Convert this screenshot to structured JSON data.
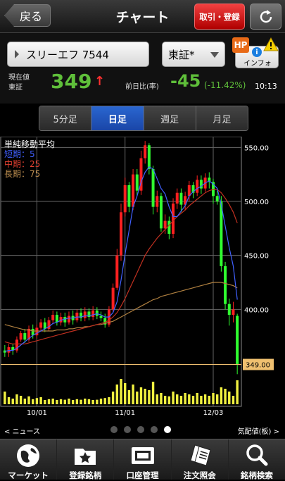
{
  "nav": {
    "back_label": "戻る",
    "title": "チャート",
    "trade_label": "取引・登録"
  },
  "stock": {
    "name": "スリーエフ 7544",
    "market": "東証*",
    "info_label": "インフォ",
    "hp_badge": "HP",
    "info_badge": "i"
  },
  "quote": {
    "current_label_1": "現在値",
    "current_label_2": "東証",
    "price": "349",
    "arrow": "↑",
    "prev_label": "前日比(率)",
    "change": "-45",
    "change_pct": "(-11.42%)",
    "time": "10:13"
  },
  "tabs": [
    {
      "label": "5分足",
      "active": false
    },
    {
      "label": "日足",
      "active": true
    },
    {
      "label": "週足",
      "active": false
    },
    {
      "label": "月足",
      "active": false
    }
  ],
  "legend": {
    "title": "単純移動平均",
    "short": "短期：5",
    "mid": "中期：25",
    "long": "長期：75"
  },
  "colors": {
    "up": "#ff2020",
    "down": "#30ff30",
    "ma_short": "#4060ff",
    "ma_mid": "#c03020",
    "ma_long": "#b08040",
    "volume": "#f0f040",
    "price_tag": "#f0c070"
  },
  "chart_data": {
    "type": "candlestick",
    "ylim": [
      335,
      560
    ],
    "y_ticks": [
      "550.00",
      "500.00",
      "450.00",
      "400.00"
    ],
    "current_price_label": "349.00",
    "current_price": 349,
    "x_ticks": [
      {
        "label": "10/01",
        "index": 8
      },
      {
        "label": "11/01",
        "index": 30
      },
      {
        "label": "12/03",
        "index": 52
      }
    ],
    "candles": [
      [
        362,
        360,
        367,
        356
      ],
      [
        360,
        365,
        368,
        356
      ],
      [
        365,
        362,
        368,
        358
      ],
      [
        362,
        372,
        375,
        360
      ],
      [
        372,
        378,
        380,
        370
      ],
      [
        378,
        372,
        382,
        369
      ],
      [
        372,
        382,
        385,
        370
      ],
      [
        382,
        376,
        386,
        373
      ],
      [
        376,
        383,
        386,
        373
      ],
      [
        383,
        388,
        391,
        380
      ],
      [
        388,
        382,
        392,
        379
      ],
      [
        382,
        390,
        393,
        380
      ],
      [
        390,
        395,
        399,
        387
      ],
      [
        395,
        388,
        398,
        385
      ],
      [
        388,
        393,
        397,
        385
      ],
      [
        393,
        388,
        397,
        384
      ],
      [
        388,
        394,
        398,
        386
      ],
      [
        394,
        390,
        399,
        386
      ],
      [
        390,
        397,
        400,
        388
      ],
      [
        397,
        392,
        401,
        389
      ],
      [
        392,
        398,
        402,
        389
      ],
      [
        398,
        393,
        401,
        390
      ],
      [
        393,
        399,
        403,
        390
      ],
      [
        399,
        394,
        402,
        391
      ],
      [
        394,
        392,
        398,
        389
      ],
      [
        392,
        386,
        396,
        383
      ],
      [
        386,
        400,
        403,
        384
      ],
      [
        400,
        420,
        424,
        398
      ],
      [
        420,
        450,
        456,
        418
      ],
      [
        450,
        490,
        498,
        445
      ],
      [
        490,
        515,
        522,
        486
      ],
      [
        515,
        495,
        518,
        490
      ],
      [
        495,
        525,
        530,
        492
      ],
      [
        525,
        510,
        530,
        505
      ],
      [
        510,
        540,
        547,
        506
      ],
      [
        540,
        552,
        556,
        535
      ],
      [
        552,
        530,
        554,
        525
      ],
      [
        530,
        495,
        533,
        488
      ],
      [
        495,
        505,
        510,
        490
      ],
      [
        505,
        475,
        508,
        472
      ],
      [
        475,
        482,
        488,
        470
      ],
      [
        482,
        470,
        486,
        465
      ],
      [
        470,
        498,
        503,
        466
      ],
      [
        498,
        508,
        512,
        493
      ],
      [
        508,
        497,
        512,
        490
      ],
      [
        497,
        505,
        509,
        492
      ],
      [
        505,
        515,
        519,
        500
      ],
      [
        515,
        508,
        518,
        503
      ],
      [
        508,
        520,
        524,
        505
      ],
      [
        520,
        512,
        524,
        507
      ],
      [
        512,
        522,
        526,
        509
      ],
      [
        522,
        518,
        527,
        512
      ],
      [
        518,
        505,
        521,
        498
      ],
      [
        505,
        500,
        510,
        497
      ],
      [
        500,
        440,
        505,
        435
      ],
      [
        440,
        405,
        444,
        400
      ],
      [
        405,
        395,
        410,
        385
      ],
      [
        395,
        400,
        407,
        388
      ],
      [
        394,
        349,
        396,
        340
      ]
    ],
    "ma_short": [
      361,
      362,
      362,
      364,
      367,
      370,
      373,
      376,
      378,
      380,
      382,
      384,
      387,
      388,
      390,
      391,
      392,
      392,
      393,
      393,
      394,
      394,
      395,
      396,
      395,
      393,
      393,
      397,
      407,
      427,
      451,
      473,
      495,
      505,
      518,
      527,
      532,
      530,
      521,
      512,
      507,
      495,
      486,
      486,
      491,
      496,
      505,
      509,
      512,
      514,
      517,
      519,
      516,
      512,
      497,
      477,
      457,
      440,
      409
    ],
    "ma_mid": [
      370,
      369,
      368,
      368,
      368,
      368,
      369,
      370,
      371,
      372,
      373,
      374,
      375,
      376,
      377,
      378,
      379,
      380,
      381,
      382,
      383,
      384,
      385,
      386,
      387,
      388,
      390,
      393,
      397,
      403,
      410,
      418,
      426,
      434,
      442,
      450,
      456,
      461,
      466,
      470,
      474,
      478,
      482,
      486,
      489,
      492,
      496,
      499,
      502,
      505,
      508,
      510,
      511,
      511,
      508,
      503,
      497,
      490,
      480
    ],
    "ma_long": [
      386,
      385,
      384,
      383,
      382,
      381,
      381,
      380,
      380,
      380,
      380,
      380,
      380,
      381,
      381,
      381,
      382,
      382,
      383,
      383,
      384,
      384,
      385,
      386,
      386,
      387,
      388,
      389,
      391,
      393,
      395,
      397,
      399,
      401,
      403,
      405,
      407,
      409,
      410,
      412,
      413,
      414,
      415,
      416,
      417,
      418,
      419,
      420,
      421,
      422,
      423,
      424,
      425,
      425,
      425,
      424,
      423,
      422,
      420
    ],
    "volume": [
      0.45,
      0.25,
      0.2,
      0.35,
      0.3,
      0.2,
      0.28,
      0.18,
      0.22,
      0.25,
      0.15,
      0.18,
      0.2,
      0.15,
      0.18,
      0.16,
      0.2,
      0.15,
      0.18,
      0.16,
      0.2,
      0.18,
      0.15,
      0.16,
      0.2,
      0.22,
      0.25,
      0.45,
      0.7,
      0.9,
      0.75,
      0.5,
      0.7,
      0.45,
      0.6,
      0.55,
      0.5,
      0.8,
      0.35,
      0.4,
      0.3,
      0.28,
      0.45,
      0.35,
      0.3,
      0.4,
      0.35,
      0.3,
      0.4,
      0.3,
      0.35,
      0.3,
      0.4,
      0.35,
      0.6,
      0.55,
      0.45,
      0.3,
      0.85
    ]
  },
  "footer": {
    "news": "< ニュース",
    "board": "気配値(板) >",
    "pages": 5,
    "current_page": 5
  },
  "tabbar": [
    "マーケット",
    "登録銘柄",
    "口座管理",
    "注文照会",
    "銘柄検索"
  ]
}
